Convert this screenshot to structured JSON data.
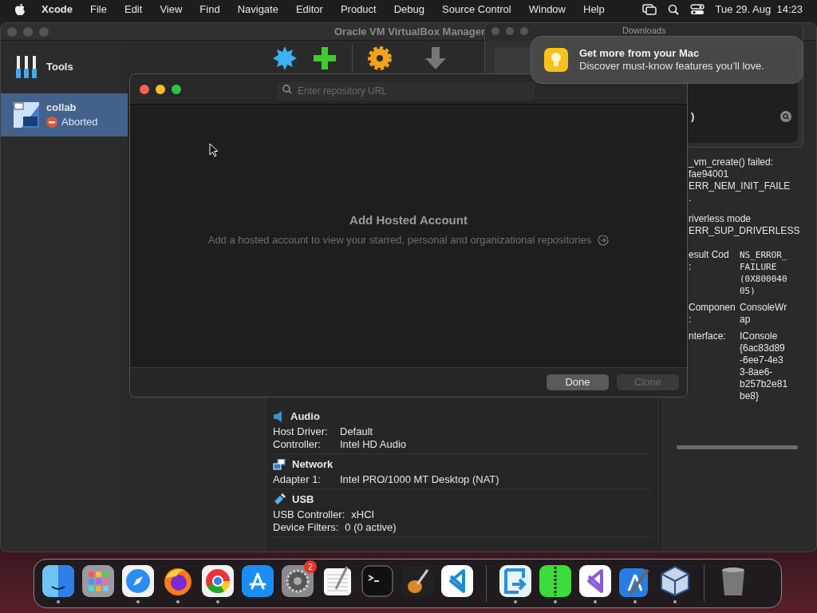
{
  "menu_bar": {
    "app": "Xcode",
    "menus": [
      "File",
      "Edit",
      "View",
      "Find",
      "Navigate",
      "Editor",
      "Product",
      "Debug",
      "Source Control",
      "Window",
      "Help"
    ],
    "clock": "Tue 29. Aug  14:23"
  },
  "virtualbox": {
    "title": "Oracle VM VirtualBox Manager",
    "tools_label": "Tools",
    "vms": [
      {
        "name": "collab",
        "state": "Aborted",
        "selected": true
      }
    ],
    "details": [
      {
        "title": "Audio",
        "kind": "audio",
        "rows": [
          {
            "label": "Host Driver:",
            "value": "Default"
          },
          {
            "label": "Controller:",
            "value": "Intel HD Audio"
          }
        ]
      },
      {
        "title": "Network",
        "kind": "network",
        "rows": [
          {
            "label": "Adapter 1:",
            "value": "Intel PRO/1000 MT Desktop (NAT)"
          }
        ]
      },
      {
        "title": "USB",
        "kind": "usb",
        "rows": [
          {
            "label": "USB Controller:",
            "value": "xHCI"
          },
          {
            "label": "Device Filters:",
            "value": "0 (0 active)"
          }
        ]
      }
    ]
  },
  "downloads": {
    "title": "Downloads",
    "header": ")"
  },
  "error_pane": {
    "error_paragraphs": [
      [
        "_vm_create() failed:",
        "fae94001",
        "ERR_NEM_INIT_FAILE",
        "."
      ],
      [
        "riverless mode",
        "ERR_SUP_DRIVERLESS"
      ]
    ],
    "error_table": [
      {
        "label_lines": [
          "esult Cod",
          ":"
        ],
        "value_lines": [
          "NS_ERROR_",
          "FAILURE",
          "(0X800040",
          "05)"
        ],
        "mono": true
      },
      {
        "label_lines": [
          "Componen",
          ":"
        ],
        "value_lines": [
          "ConsoleWr",
          "ap"
        ],
        "mono": false
      },
      {
        "label_lines": [
          "nterface:"
        ],
        "value_lines": [
          "IConsole",
          "{6ac83d89",
          "-6ee7-4e3",
          "3-8ae6-",
          "b257b2e81",
          "be8}"
        ],
        "mono": false
      }
    ]
  },
  "notification": {
    "title": "Get more from your Mac",
    "body": "Discover must-know features you’ll love."
  },
  "xcode_dialog": {
    "search": {
      "placeholder": "Enter repository URL"
    },
    "heading": "Add Hosted Account",
    "message": "Add a hosted account to view your starred, personal and organizational repositories",
    "buttons": [
      {
        "label": "Done",
        "disabled": false
      },
      {
        "label": "Clone",
        "disabled": true
      }
    ]
  },
  "dock": {
    "items": [
      {
        "kind": "finder",
        "running": true
      },
      {
        "kind": "launchpad",
        "running": false
      },
      {
        "kind": "safari",
        "running": true
      },
      {
        "kind": "firefox",
        "running": true
      },
      {
        "kind": "chrome",
        "running": true
      },
      {
        "kind": "appstore",
        "running": false
      },
      {
        "kind": "settings",
        "running": false,
        "badge": "2"
      },
      {
        "kind": "textedit",
        "running": false
      },
      {
        "kind": "terminal",
        "running": false
      },
      {
        "kind": "garageband",
        "running": false
      },
      {
        "kind": "vscode",
        "running": false
      },
      {
        "kind": "separator"
      },
      {
        "kind": "migration",
        "running": true
      },
      {
        "kind": "archive",
        "running": true
      },
      {
        "kind": "visualstudio",
        "running": true
      },
      {
        "kind": "xcode",
        "running": true
      },
      {
        "kind": "virtualbox",
        "running": true
      },
      {
        "kind": "separator"
      },
      {
        "kind": "trash",
        "running": false
      }
    ]
  }
}
